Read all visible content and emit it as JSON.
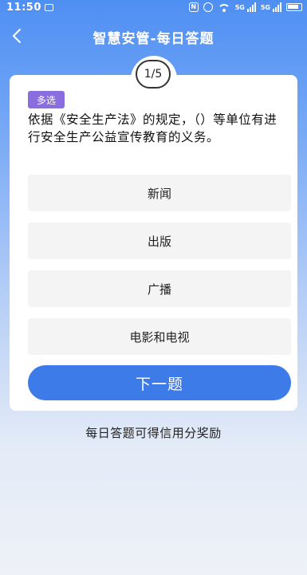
{
  "status_bar": {
    "time": "11:50",
    "nfc": "N",
    "signal_1_label": "5G",
    "signal_2_label": "5G"
  },
  "header": {
    "title": "智慧安管-每日答题"
  },
  "quiz": {
    "progress": "1/5",
    "type_badge": "多选",
    "question": "依据《安全生产法》的规定，（）等单位有进行安全生产公益宣传教育的义务。",
    "options": [
      {
        "label": "新闻"
      },
      {
        "label": "出版"
      },
      {
        "label": "广播"
      },
      {
        "label": "电影和电视"
      }
    ],
    "next_label": "下一题"
  },
  "footer": {
    "note": "每日答题可得信用分奖励"
  },
  "colors": {
    "header_blue": "#4f8ff2",
    "button_blue": "#3d7be8",
    "badge_purple": "#8a6ee0"
  }
}
